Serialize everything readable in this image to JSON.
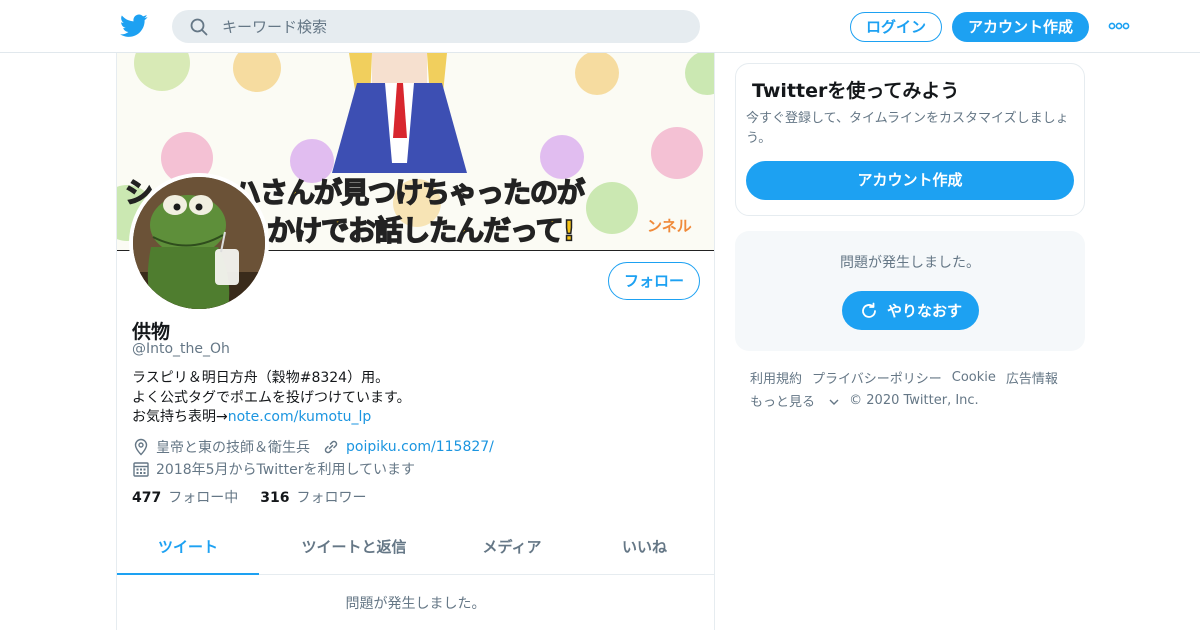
{
  "header": {
    "search_placeholder": "キーワード検索",
    "login_label": "ログイン",
    "signup_label": "アカウント作成"
  },
  "banner": {
    "caption_line1": "シ　　ナハさんが見つけちゃったのが",
    "caption_line2": "かけでお話したんだって!",
    "caption_side": "ンネル"
  },
  "profile": {
    "display_name": "供物",
    "handle": "@Into_the_Oh",
    "follow_label": "フォロー",
    "bio_line1": "ラスピリ＆明日方舟（穀物#8324）用。",
    "bio_line2": "よく公式タグでポエムを投げつけています。",
    "bio_line3_prefix": "お気持ち表明→",
    "bio_link": "note.com/kumotu_lp",
    "location": "皇帝と東の技師＆衛生兵",
    "website": "poipiku.com/115827/",
    "joined": "2018年5月からTwitterを利用しています",
    "following_count": "477",
    "following_label": "フォロー中",
    "followers_count": "316",
    "followers_label": "フォロワー"
  },
  "tabs": [
    {
      "label": "ツイート"
    },
    {
      "label": "ツイートと返信"
    },
    {
      "label": "メディア"
    },
    {
      "label": "いいね"
    }
  ],
  "timeline_error": "問題が発生しました。",
  "signup_card": {
    "title": "Twitterを使ってみよう",
    "description": "今すぐ登録して、タイムラインをカスタマイズしましょう。",
    "button_label": "アカウント作成"
  },
  "error_card": {
    "message": "問題が発生しました。",
    "retry_label": "やりなおす"
  },
  "footer": {
    "links": [
      "利用規約",
      "プライバシーポリシー",
      "Cookie",
      "広告情報"
    ],
    "more_label": "もっと見る",
    "copyright": "© 2020 Twitter, Inc."
  },
  "colors": {
    "accent": "#1da1f2",
    "link": "#1b95e0",
    "muted": "#657786",
    "text": "#14171a"
  },
  "icons": [
    "twitter-bird-icon",
    "search-icon",
    "more-dots-icon",
    "location-pin-icon",
    "link-icon",
    "calendar-icon",
    "refresh-icon",
    "chevron-down-icon"
  ]
}
